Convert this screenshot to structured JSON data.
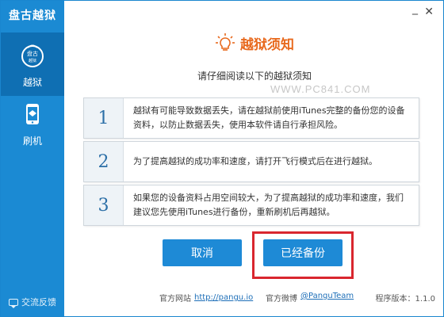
{
  "app": {
    "title": "盘古越狱"
  },
  "sidebar": {
    "items": [
      {
        "label": "越狱",
        "icon": "pangu-logo-icon"
      },
      {
        "label": "刷机",
        "icon": "iphone-icon"
      }
    ],
    "feedback_label": "交流反馈"
  },
  "header": {
    "title": "越狱须知",
    "subtitle": "请仔细阅读以下的越狱须知",
    "watermark": "WWW.PC841.COM"
  },
  "notices": [
    {
      "num": "1",
      "text": "越狱有可能导致数据丢失，请在越狱前使用iTunes完整的备份您的设备资料，以防止数据丢失，使用本软件请自行承担风险。"
    },
    {
      "num": "2",
      "text": "为了提高越狱的成功率和速度，请打开飞行模式后在进行越狱。"
    },
    {
      "num": "3",
      "text": "如果您的设备资料占用空间较大，为了提高越狱的成功率和速度，我们建议您先使用iTunes进行备份，重新刷机后再越狱。"
    }
  ],
  "buttons": {
    "cancel": "取消",
    "backed_up": "已经备份"
  },
  "footer": {
    "site_label": "官方网站",
    "site_link": "http://pangu.io",
    "weibo_label": "官方微博",
    "weibo_link": "@PanguTeam",
    "version": "程序版本：1.1.0"
  },
  "colors": {
    "sidebar": "#1b8ad3",
    "accent": "#1e8ad6",
    "title": "#e8691d",
    "highlight": "#d9262e"
  }
}
